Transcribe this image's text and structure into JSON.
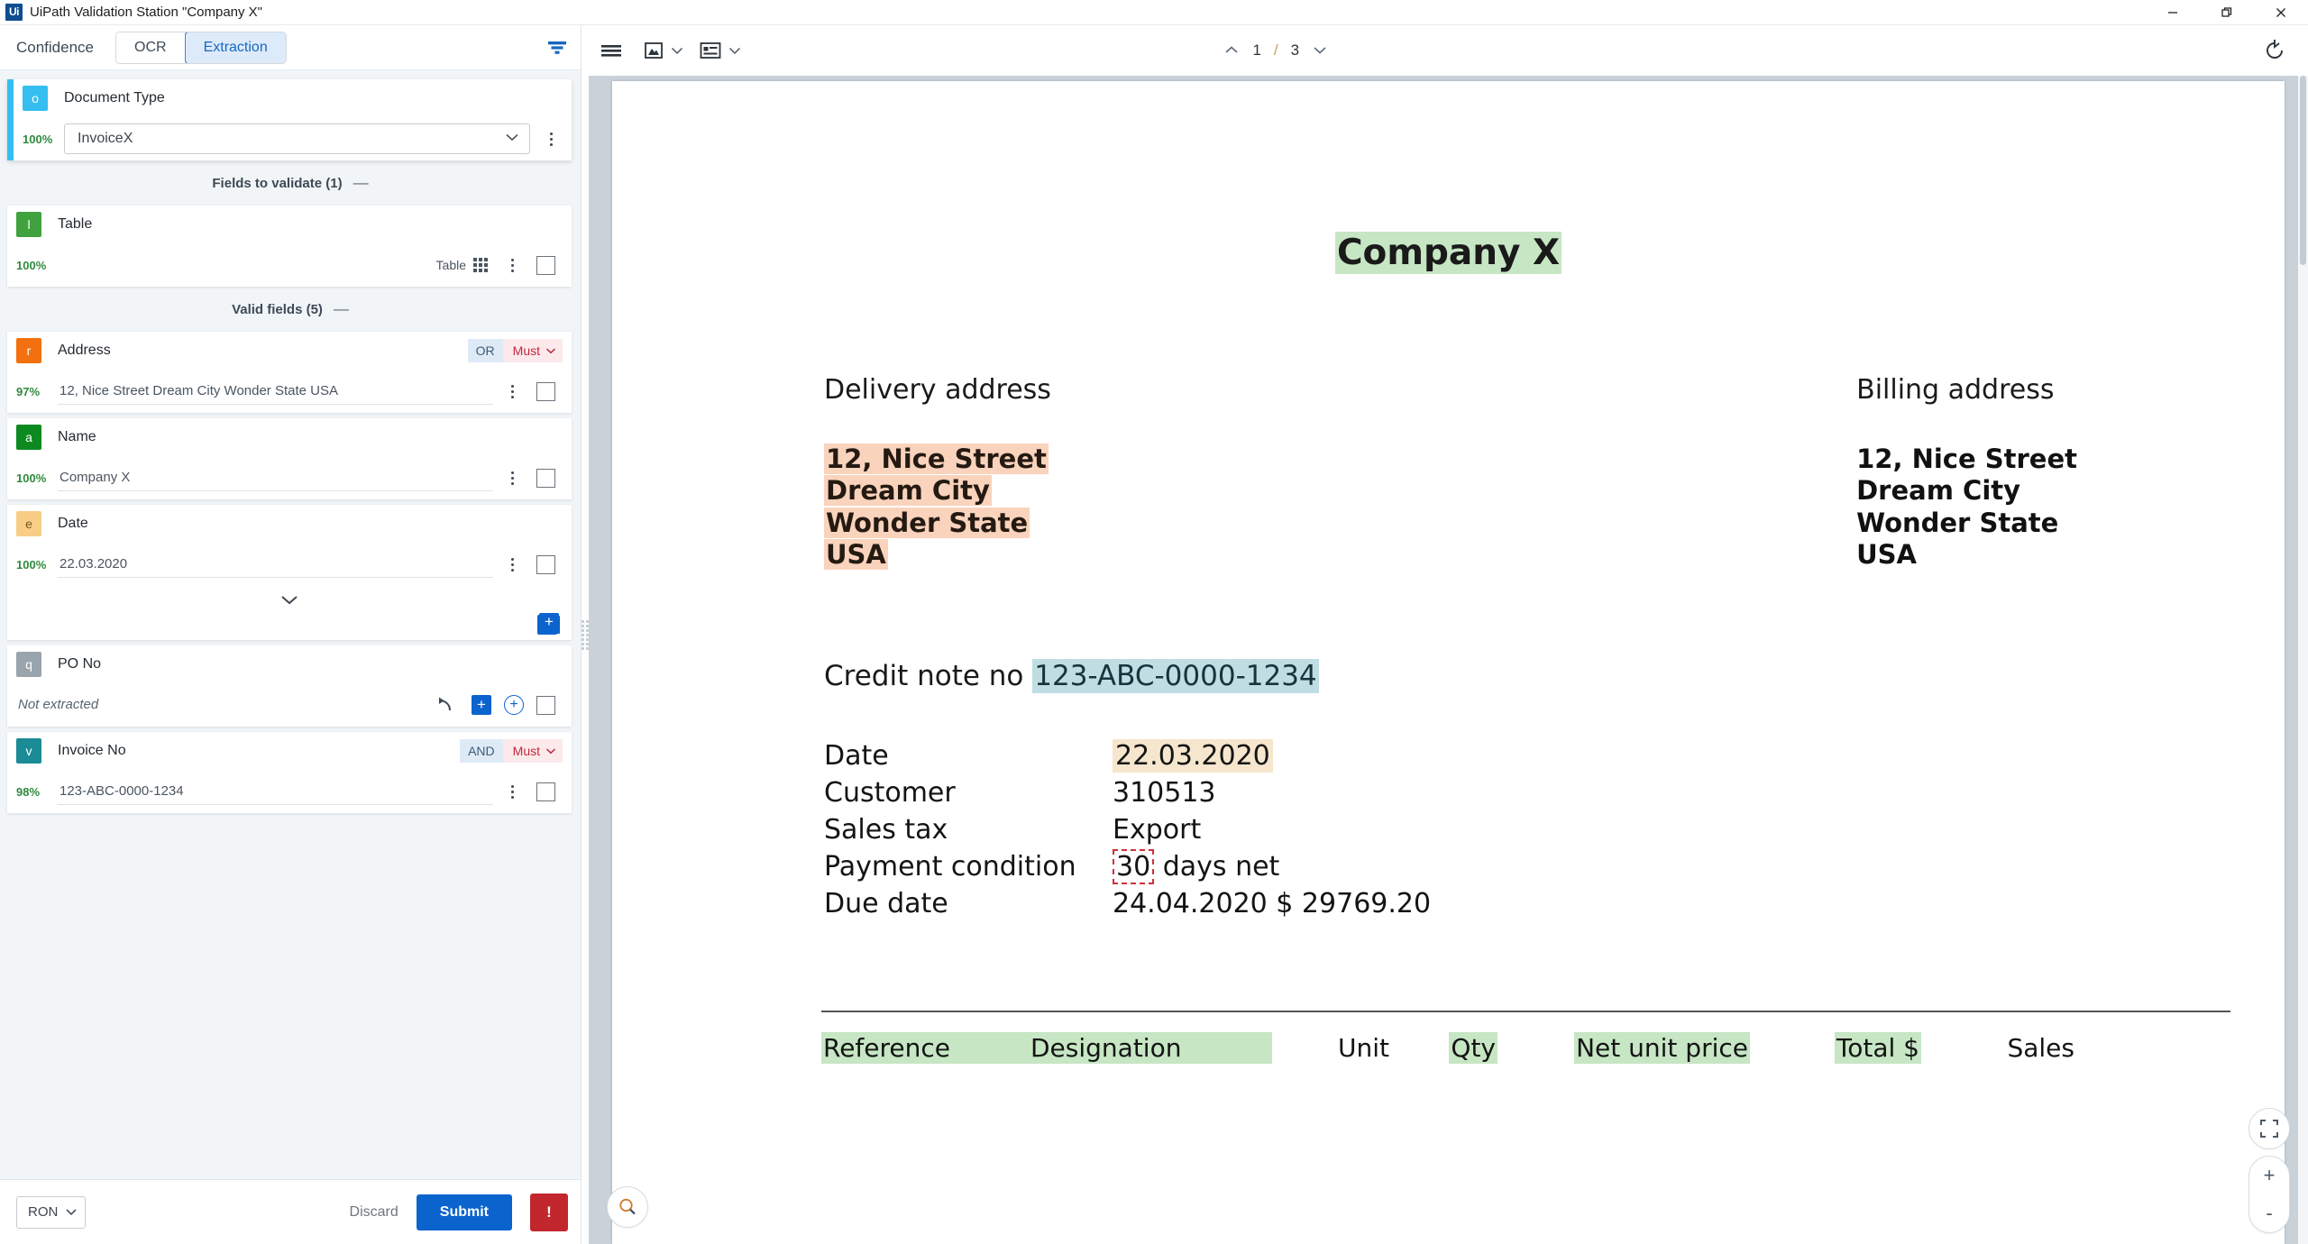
{
  "window": {
    "title": "UiPath Validation Station \"Company X\"",
    "logo_text": "Ui",
    "minimize": "minimize-icon",
    "restore": "restore-icon",
    "close": "close-icon"
  },
  "left_panel": {
    "header": {
      "confidence_label": "Confidence",
      "segments": [
        {
          "label": "OCR",
          "active": false
        },
        {
          "label": "Extraction",
          "active": true
        }
      ],
      "filter_icon": "filter-icon"
    },
    "document_type": {
      "badge": "o",
      "badge_color": "#35bef0",
      "accent_color": "#35bef0",
      "label": "Document Type",
      "confidence": "100%",
      "value": "InvoiceX"
    },
    "sections": [
      {
        "title": "Fields to validate (1)",
        "collapse": "—"
      },
      {
        "title": "Valid fields (5)",
        "collapse": "—"
      }
    ],
    "fields_to_validate": [
      {
        "badge": "l",
        "badge_color": "#3fa23f",
        "label": "Table",
        "confidence": "100%",
        "value": "",
        "type": "table",
        "table_label": "Table"
      }
    ],
    "valid_fields": [
      {
        "badge": "r",
        "badge_color": "#f2700f",
        "label": "Address",
        "confidence": "97%",
        "value": "12, Nice Street Dream City Wonder State USA",
        "operator": "OR",
        "requirement": "Must"
      },
      {
        "badge": "a",
        "badge_color": "#0d8a1f",
        "label": "Name",
        "confidence": "100%",
        "value": "Company X"
      },
      {
        "badge": "e",
        "badge_color": "#f8cd86",
        "label": "Date",
        "confidence": "100%",
        "value": "22.03.2020",
        "has_expand": true,
        "add_page_icon": "add-page-icon"
      },
      {
        "badge": "q",
        "badge_color": "#9aa4ad",
        "label": "PO No",
        "confidence": "",
        "value": "Not extracted",
        "not_extracted": true,
        "actions": [
          "undo-icon",
          "add-square-icon",
          "add-circle-icon"
        ]
      },
      {
        "badge": "v",
        "badge_color": "#1b8b96",
        "label": "Invoice No",
        "confidence": "98%",
        "value": "123-ABC-0000-1234",
        "operator": "AND",
        "requirement": "Must"
      }
    ],
    "footer": {
      "currency": "RON",
      "discard_label": "Discard",
      "submit_label": "Submit",
      "alert_label": "!"
    }
  },
  "viewer": {
    "toolbar": {
      "menu_icon": "hamburger-menu-icon",
      "image_mode_icon": "image-view-icon",
      "layout_mode_icon": "layout-view-icon",
      "page_current": "1",
      "page_sep": "/",
      "page_total": "3",
      "prev_icon": "chevron-up-icon",
      "next_icon": "chevron-down-icon",
      "rotate_icon": "rotate-icon"
    },
    "controls": {
      "search_icon": "search-icon",
      "fit_icon": "fit-to-screen-icon",
      "zoom_in": "+",
      "zoom_out": "-"
    },
    "document": {
      "company_title": "Company X",
      "delivery_heading": "Delivery address",
      "billing_heading": "Billing address",
      "delivery_address": [
        "12, Nice Street",
        "Dream City",
        "Wonder State",
        "USA"
      ],
      "billing_address": [
        "12, Nice Street",
        "Dream City",
        "Wonder State",
        "USA"
      ],
      "credit_note_label": "Credit note no",
      "credit_note_value": "123-ABC-0000-1234",
      "details": [
        {
          "key": "Date",
          "value": "22.03.2020",
          "highlight": "cream"
        },
        {
          "key": "Customer",
          "value": "310513",
          "highlight": "none"
        },
        {
          "key": "Sales tax",
          "value": "Export",
          "highlight": "none"
        },
        {
          "key": "Payment condition",
          "value_selected": "30",
          "value_rest": " days net",
          "highlight": "selection"
        },
        {
          "key": "Due date",
          "value": "24.04.2020 $ 29769.20",
          "highlight": "none"
        }
      ],
      "table_headers": [
        {
          "text": "Reference",
          "highlight": true
        },
        {
          "text": "Designation",
          "highlight": true
        },
        {
          "text": "Unit",
          "highlight": false
        },
        {
          "text": "Qty",
          "highlight": true
        },
        {
          "text": "Net unit price",
          "highlight": true
        },
        {
          "text": "Total $",
          "highlight": true
        },
        {
          "text": "Sales",
          "highlight": false
        }
      ]
    }
  }
}
